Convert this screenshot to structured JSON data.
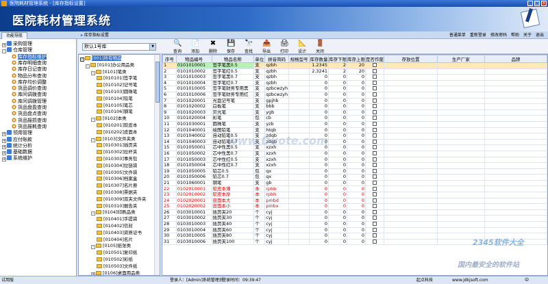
{
  "window": {
    "title": "医院耗材管理系统 - [库存指标设置]"
  },
  "banner": {
    "logo": "医院耗材管理系统"
  },
  "nav": {
    "tab": "功能导航",
    "page_title": "库存指标设置"
  },
  "toplinks": [
    "普通菜单",
    "重新登录",
    "修改密码",
    "帮助",
    "关于",
    "退出"
  ],
  "sidebar": {
    "items": [
      {
        "label": "采购管理",
        "level": 0,
        "exp": "+",
        "icon": "pkg"
      },
      {
        "label": "仓库管理",
        "level": 0,
        "exp": "-",
        "icon": "pkg"
      },
      {
        "label": "库存指标维护",
        "level": 1,
        "icon": "gear",
        "selected": true
      },
      {
        "label": "库存明细查询",
        "level": 1,
        "icon": "gear"
      },
      {
        "label": "库存日记查询",
        "level": 1,
        "icon": "gear"
      },
      {
        "label": "物品分布查询",
        "level": 1,
        "icon": "gear"
      },
      {
        "label": "库存均价调整",
        "level": 1,
        "icon": "gear"
      },
      {
        "label": "货品调价查询",
        "level": 1,
        "icon": "gear"
      },
      {
        "label": "库间调拨查询",
        "level": 1,
        "icon": "gear"
      },
      {
        "label": "库间调拨管理",
        "level": 1,
        "icon": "gear"
      },
      {
        "label": "货品盘盈查询",
        "level": 1,
        "icon": "gear"
      },
      {
        "label": "货品盘点查询",
        "level": 1,
        "icon": "gear"
      },
      {
        "label": "货品报损查询",
        "level": 1,
        "icon": "gear"
      },
      {
        "label": "货品报耗查询",
        "level": 1,
        "icon": "gear"
      },
      {
        "label": "领用管理",
        "level": 0,
        "exp": "+",
        "icon": "pkg"
      },
      {
        "label": "应付账款",
        "level": 0,
        "exp": "+",
        "icon": "pkg"
      },
      {
        "label": "统计分析",
        "level": 0,
        "exp": "+",
        "icon": "pkg"
      },
      {
        "label": "基础数据",
        "level": 0,
        "exp": "+",
        "icon": "pkg"
      },
      {
        "label": "系统维护",
        "level": 0,
        "exp": "+",
        "icon": "pkg"
      }
    ]
  },
  "warehouse_select": "默认1号库",
  "toolbar": [
    {
      "label": "查询",
      "icon": "🔍"
    },
    {
      "label": "添加",
      "icon": "📄"
    },
    {
      "label": "删除",
      "icon": "✖"
    },
    {
      "label": "保存",
      "icon": "💾"
    },
    {
      "label": "查找",
      "icon": "🔭"
    },
    {
      "label": "导出",
      "icon": "📤"
    },
    {
      "label": "打印",
      "icon": "🖨"
    },
    {
      "label": "设计",
      "icon": "📐"
    },
    {
      "label": "关闭",
      "icon": "🚪"
    }
  ],
  "category_tree": [
    {
      "label": "[001]所有物品",
      "level": 0,
      "chk": "✓",
      "sel": true
    },
    {
      "label": "[0101]办公用品类",
      "level": 1,
      "exp": "-"
    },
    {
      "label": "[0101]笔类",
      "level": 2,
      "exp": "-"
    },
    {
      "label": "[010101]签字笔",
      "level": 3
    },
    {
      "label": "[010102]记号笔",
      "level": 3
    },
    {
      "label": "[010103]圆珠笔",
      "level": 3
    },
    {
      "label": "[010104]铅笔",
      "level": 3
    },
    {
      "label": "[010105]笔芯",
      "level": 3
    },
    {
      "label": "[010106]钢笔",
      "level": 3
    },
    {
      "label": "[0102]本类",
      "level": 2,
      "exp": "-"
    },
    {
      "label": "[010201]软皮本",
      "level": 3
    },
    {
      "label": "[010202]皮面本",
      "level": 3
    },
    {
      "label": "[0103]文件夹类",
      "level": 2,
      "exp": "-"
    },
    {
      "label": "[010301]插页夹",
      "level": 3
    },
    {
      "label": "[010302]拉杆夹",
      "level": 3
    },
    {
      "label": "[010303]事务包",
      "level": 3
    },
    {
      "label": "[010304]拉链袋",
      "level": 3
    },
    {
      "label": "[010305]文件袋",
      "level": 3
    },
    {
      "label": "[010306]档案盒",
      "level": 3
    },
    {
      "label": "[010307]名片册",
      "level": 3
    },
    {
      "label": "[010308]票据夹",
      "level": 3
    },
    {
      "label": "[010309]双夹文件夹",
      "level": 3
    },
    {
      "label": "[010310]报告夹",
      "level": 3
    },
    {
      "label": "[0104]印刷品类",
      "level": 2,
      "exp": "-"
    },
    {
      "label": "[010401]手提袋",
      "level": 3
    },
    {
      "label": "[010402]信封",
      "level": 3
    },
    {
      "label": "[010403]资质证书",
      "level": 3
    },
    {
      "label": "[010404]名片",
      "level": 3
    },
    {
      "label": "[0105]纸张类",
      "level": 2,
      "exp": "-"
    },
    {
      "label": "[010501]复印纸",
      "level": 3
    },
    {
      "label": "[010502]彩纸",
      "level": 3
    },
    {
      "label": "[010503]文件纸",
      "level": 3
    },
    {
      "label": "[0106]桌面用品类",
      "level": 2,
      "exp": "+"
    }
  ],
  "grid": {
    "columns": [
      "序号",
      "物品编号",
      "物品名称",
      "单位",
      "拼音简码",
      "规格型号",
      "库存数量",
      "库存下限",
      "库存上限",
      "是否作废",
      "存放位置",
      "生产厂家",
      "品牌"
    ],
    "rows": [
      [
        "1",
        "0101010001",
        "签字笔黑0.5",
        "支",
        "qzbh",
        "",
        "1.2345",
        "2",
        "20"
      ],
      [
        "2",
        "0101010002",
        "签字笔红0.5",
        "支",
        "qzbh",
        "",
        "2.3241",
        "2",
        "20"
      ],
      [
        "3",
        "0101010003",
        "签字笔黑0.7",
        "支",
        "qzbh",
        "",
        "0",
        "0",
        "0"
      ],
      [
        "4",
        "0101010004",
        "签字笔红0.7",
        "支",
        "qzbh",
        "",
        "0",
        "0",
        "0"
      ],
      [
        "5",
        "0101010005",
        "签字笔财务专用黑",
        "支",
        "qzbcwzyh",
        "",
        "0",
        "0",
        "0"
      ],
      [
        "6",
        "0101010006",
        "签字笔财务专用红",
        "支",
        "qzbcwzyh",
        "",
        "0",
        "0",
        "0"
      ],
      [
        "7",
        "0101020001",
        "光盘记号笔",
        "支",
        "gpjhb",
        "",
        "0",
        "0",
        "0"
      ],
      [
        "8",
        "0101020002",
        "白板笔",
        "支",
        "bbb",
        "",
        "0",
        "0",
        "0"
      ],
      [
        "9",
        "0101020003",
        "荧光笔",
        "支",
        "ygb",
        "",
        "0",
        "0",
        "0"
      ],
      [
        "10",
        "0101020004",
        "彩笔",
        "包",
        "cb",
        "",
        "0",
        "0",
        "0"
      ],
      [
        "11",
        "0101030001",
        "圆珠笔",
        "支",
        "yzb",
        "",
        "0",
        "0",
        "0"
      ],
      [
        "12",
        "0101040001",
        "绘图铅笔",
        "支",
        "htqb",
        "",
        "0",
        "0",
        "0"
      ],
      [
        "13",
        "0101040002",
        "自动铅笔0.5",
        "支",
        "zdqb",
        "",
        "0",
        "0",
        "0"
      ],
      [
        "14",
        "0101040003",
        "自动铅笔0.7",
        "支",
        "zdqb",
        "",
        "0",
        "0",
        "0"
      ],
      [
        "15",
        "0101050001",
        "芯中性黑0.5",
        "支",
        "xzxh",
        "",
        "0",
        "0",
        "0"
      ],
      [
        "16",
        "0101050002",
        "芯中性黑0.7",
        "支",
        "xzxh",
        "",
        "0",
        "0",
        "0"
      ],
      [
        "17",
        "0101050003",
        "芯中性红0.5",
        "支",
        "xzxh",
        "",
        "0",
        "0",
        "0"
      ],
      [
        "18",
        "0101050004",
        "芯中性红0.7",
        "支",
        "xzxh",
        "",
        "0",
        "0",
        "0"
      ],
      [
        "19",
        "0101050005",
        "铅芯0.5",
        "包",
        "qx",
        "",
        "0",
        "0",
        "0"
      ],
      [
        "20",
        "0101050006",
        "铅芯0.7",
        "包",
        "qx",
        "",
        "0",
        "0",
        "0"
      ],
      [
        "21",
        "0101060001",
        "钢笔",
        "支",
        "gb",
        "",
        "0",
        "0",
        "0"
      ],
      [
        "22",
        "0102010001",
        "软皮本薄",
        "本",
        "rpbb",
        "",
        "0",
        "0",
        "0"
      ],
      [
        "23",
        "0102010002",
        "软皮本厚",
        "本",
        "rpbh",
        "",
        "0",
        "0",
        "0"
      ],
      [
        "24",
        "0102020001",
        "皮面本大",
        "本",
        "pmbd",
        "",
        "0",
        "0",
        "0"
      ],
      [
        "25",
        "0102020002",
        "皮面本小",
        "本",
        "pmbx",
        "",
        "0",
        "0",
        "0"
      ],
      [
        "26",
        "0103010001",
        "插页夹20",
        "个",
        "cyj",
        "",
        "0",
        "0",
        "0"
      ],
      [
        "27",
        "0103010002",
        "插页夹30",
        "个",
        "cyj",
        "",
        "0",
        "0",
        "0"
      ],
      [
        "28",
        "0103010003",
        "插页夹40",
        "个",
        "cyj",
        "",
        "0",
        "0",
        "0"
      ],
      [
        "29",
        "0103010004",
        "插页夹60",
        "个",
        "cyj",
        "",
        "0",
        "0",
        "0"
      ],
      [
        "30",
        "0103010005",
        "插页夹80",
        "个",
        "cyj",
        "",
        "0",
        "0",
        "0"
      ],
      [
        "31",
        "0103010006",
        "插页夹100",
        "个",
        "cyj",
        "",
        "0",
        "0",
        "0"
      ]
    ],
    "red_rows": [
      22,
      23,
      24,
      25
    ]
  },
  "status": {
    "mode": "试用版",
    "login": "登录人：[Admin]系统管理员",
    "time": "登录时间：09:39:47",
    "company": "起点科技",
    "site": "www.jdkjsoft.com",
    "ime": "中"
  },
  "watermarks": {
    "center": "www.Duote.com",
    "brand": "2345软件大全",
    "slogan": "国内最安全的软件站"
  }
}
